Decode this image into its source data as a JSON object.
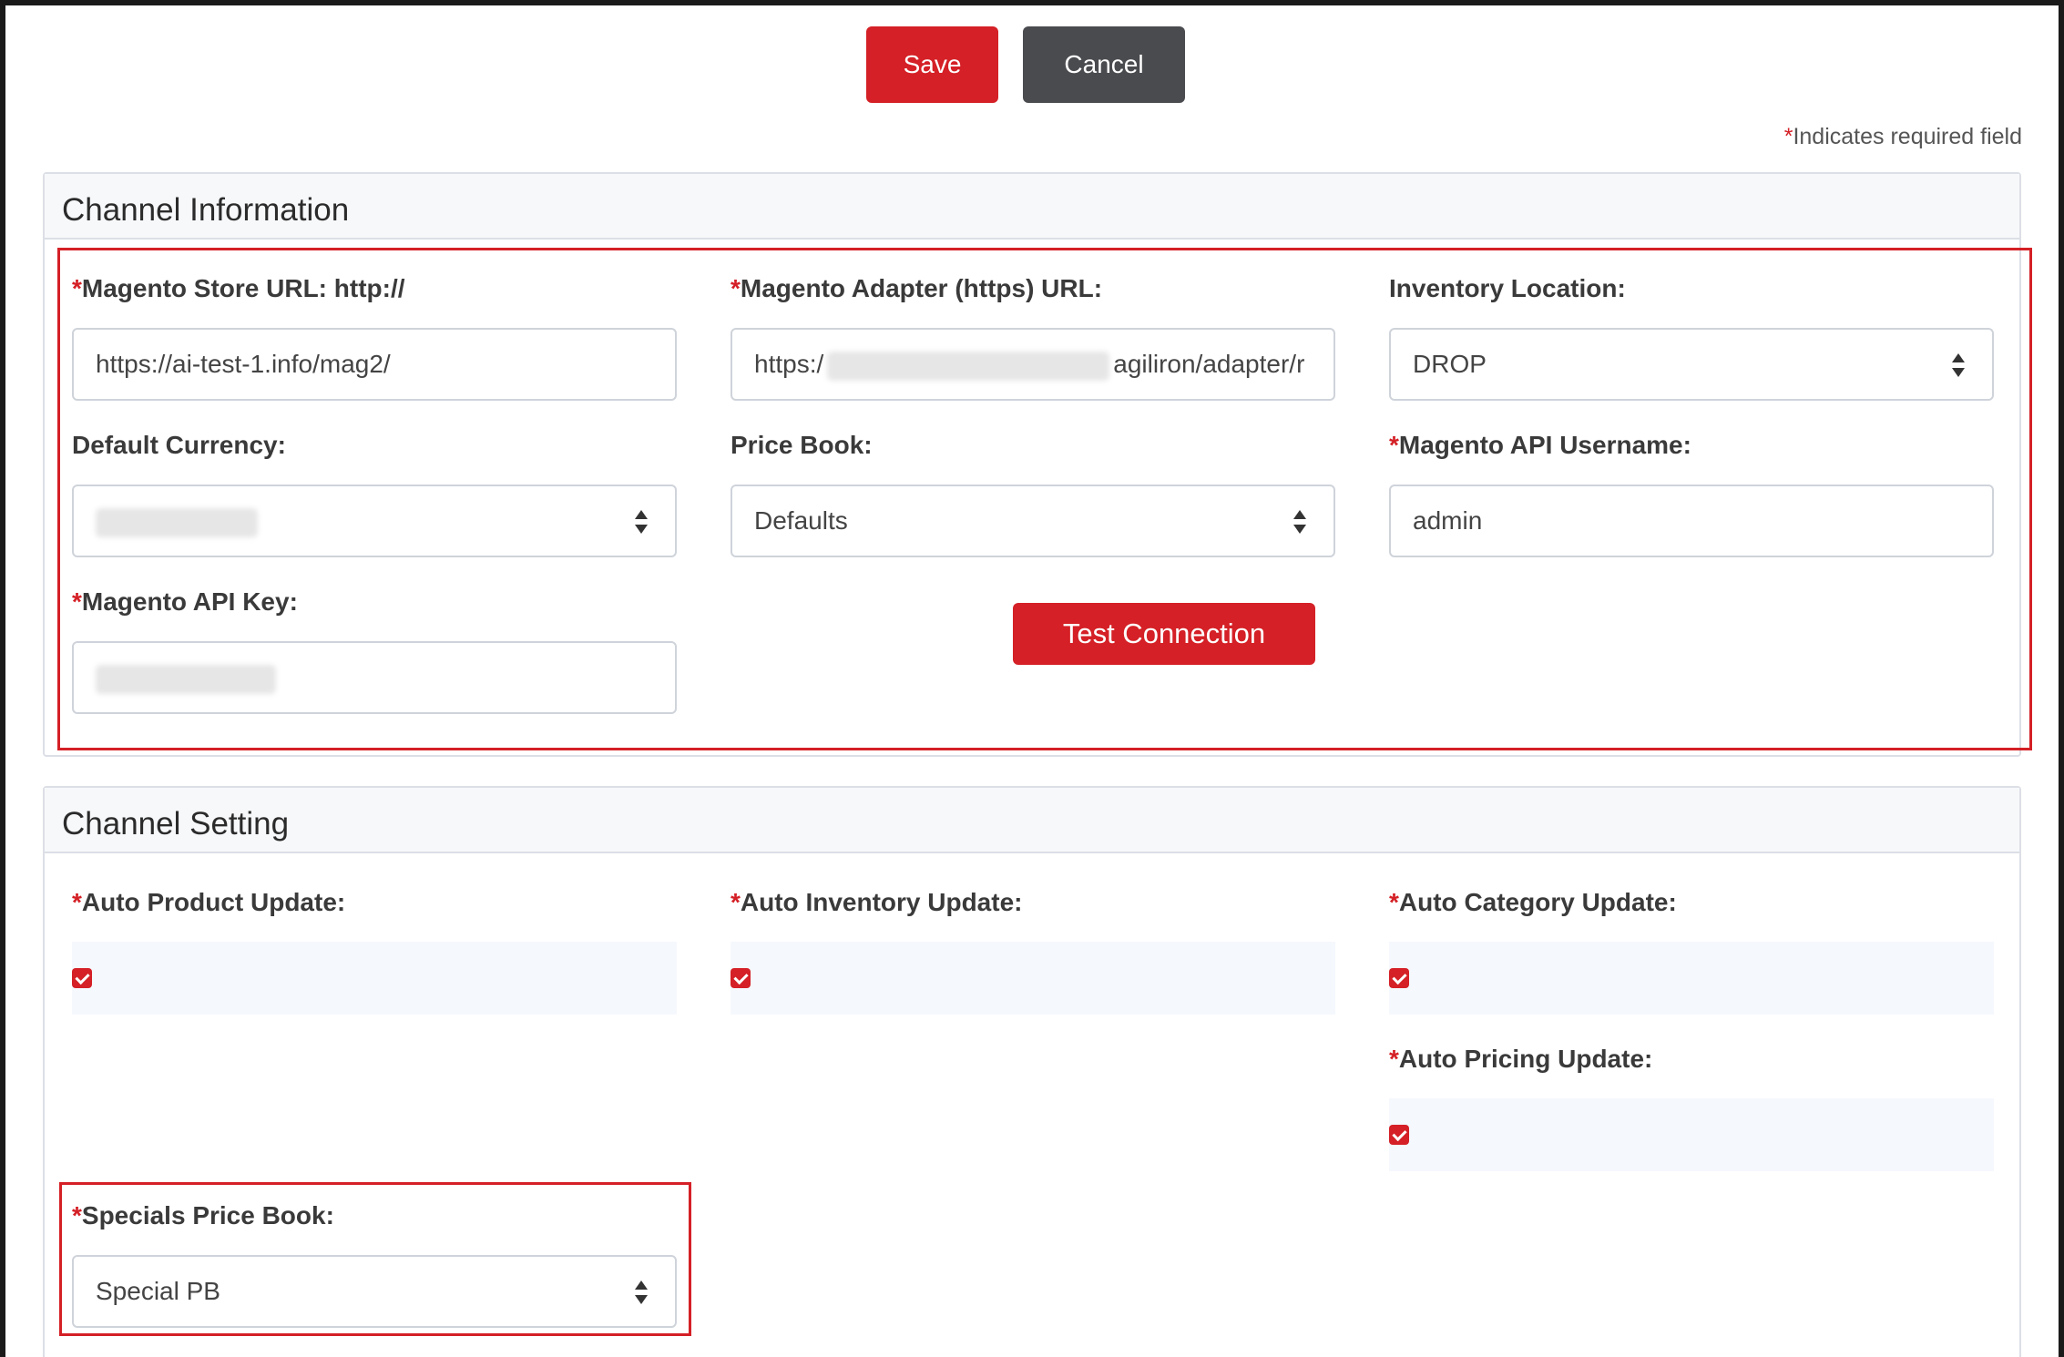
{
  "toolbar": {
    "save_label": "Save",
    "cancel_label": "Cancel"
  },
  "required_note": {
    "star": "*",
    "text": "Indicates required field"
  },
  "channel_information": {
    "title": "Channel Information",
    "store_url": {
      "label": "Magento Store URL: http://",
      "value": "https://ai-test-1.info/mag2/"
    },
    "adapter_url": {
      "label": "Magento Adapter (https) URL:",
      "value_start": "https:/",
      "value_end": "agiliron/adapter/r"
    },
    "inventory_location": {
      "label": "Inventory Location:",
      "value": "DROP"
    },
    "default_currency": {
      "label": "Default Currency:"
    },
    "price_book": {
      "label": "Price Book:",
      "value": "Defaults"
    },
    "api_username": {
      "label": "Magento API Username:",
      "value": "admin"
    },
    "api_key": {
      "label": "Magento API Key:"
    },
    "test_connection_label": "Test Connection"
  },
  "channel_setting": {
    "title": "Channel Setting",
    "auto_product_update": {
      "label": "Auto Product Update:",
      "checked": true
    },
    "auto_inventory_update": {
      "label": "Auto Inventory Update:",
      "checked": true
    },
    "auto_category_update": {
      "label": "Auto Category Update:",
      "checked": true
    },
    "auto_pricing_update": {
      "label": "Auto Pricing Update:",
      "checked": true
    },
    "specials_price_book": {
      "label": "Specials Price Book:",
      "value": "Special PB"
    }
  },
  "colors": {
    "accent": "#d42026",
    "cancel": "#4a4b4f",
    "border": "#cfd3da"
  }
}
